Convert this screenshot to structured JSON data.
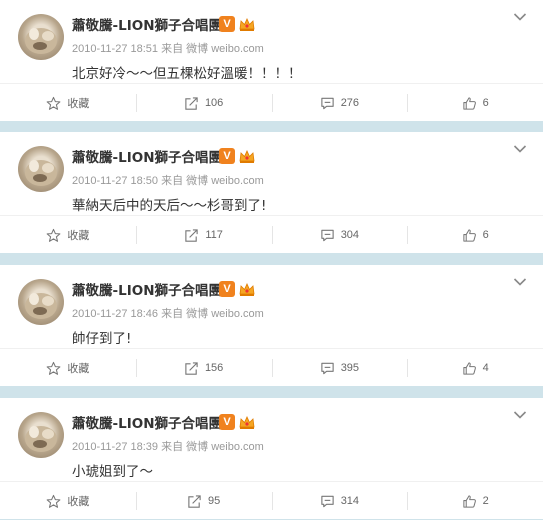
{
  "posts": [
    {
      "author": "蕭敬騰-LION獅子合唱團",
      "verified_label": "V",
      "meta": "2010-11-27 18:51 来自 微博 weibo.com",
      "text": "北京好冷～～但五棵松好溫暖！！！！",
      "favorite_label": "收藏",
      "repost_count": "106",
      "comment_count": "276",
      "like_count": "6"
    },
    {
      "author": "蕭敬騰-LION獅子合唱團",
      "verified_label": "V",
      "meta": "2010-11-27 18:50 来自 微博 weibo.com",
      "text": "華納天后中的天后～～杉哥到了!",
      "favorite_label": "收藏",
      "repost_count": "117",
      "comment_count": "304",
      "like_count": "6"
    },
    {
      "author": "蕭敬騰-LION獅子合唱團",
      "verified_label": "V",
      "meta": "2010-11-27 18:46 来自 微博 weibo.com",
      "text": "帥仔到了!",
      "favorite_label": "收藏",
      "repost_count": "156",
      "comment_count": "395",
      "like_count": "4"
    },
    {
      "author": "蕭敬騰-LION獅子合唱團",
      "verified_label": "V",
      "meta": "2010-11-27 18:39 来自 微博 weibo.com",
      "text": "小琥姐到了～",
      "favorite_label": "收藏",
      "repost_count": "95",
      "comment_count": "314",
      "like_count": "2"
    }
  ],
  "colors": {
    "background": "#cfe3ea",
    "verified_badge": "#f0821e",
    "meta_text": "#999999"
  },
  "icons": [
    "chevron-down-icon",
    "star-icon",
    "repost-icon",
    "comment-icon",
    "thumbs-up-icon",
    "crown-icon"
  ]
}
